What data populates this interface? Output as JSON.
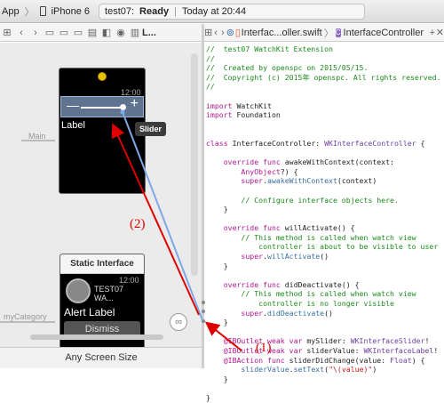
{
  "toolbar": {
    "scheme": "App",
    "separator": "〉",
    "device": "iPhone 6",
    "status_app": "test07:",
    "status_state": "Ready",
    "status_divider": "|",
    "status_time": "Today at 20:44"
  },
  "left_jump": {
    "crumb": "L..."
  },
  "right_jump": {
    "file": "Interfac...oller.swift",
    "sep": "〉",
    "class_name": "InterfaceController"
  },
  "canvas": {
    "time1": "12:00",
    "time2": "12:00",
    "label": "Label",
    "tooltip": "Slider",
    "main_segue": "Main",
    "category_segue": "myCategory",
    "static_title": "Static Interface",
    "app_name": "TEST07 WA...",
    "alert_label": "Alert Label",
    "dismiss": "Dismiss"
  },
  "bottom": {
    "size_label": "Any Screen Size"
  },
  "annotations": {
    "a1": "(1)",
    "a2": "(2)"
  },
  "code": {
    "l1": "//  test07 WatchKit Extension",
    "l2": "//",
    "l3": "//  Created by openspc on 2015/05/15.",
    "l4": "//  Copyright (c) 2015年 openspc. All rights reserved.",
    "l5": "//",
    "l7a": "import",
    "l7b": " WatchKit",
    "l8a": "import",
    "l8b": " Foundation",
    "l11a": "class",
    "l11b": " InterfaceController: ",
    "l11c": "WKInterfaceController",
    "l11d": " {",
    "l13a": "    override func",
    "l13b": " awakeWithContext(context:",
    "l14a": "        AnyObject",
    "l14b": "?) {",
    "l15a": "        super",
    "l15b": ".",
    "l15c": "awakeWithContext",
    "l15d": "(context)",
    "l17": "        // Configure interface objects here.",
    "l18": "    }",
    "l20a": "    override func",
    "l20b": " willActivate() {",
    "l21": "        // This method is called when watch view",
    "l22": "            controller is about to be visible to user",
    "l23a": "        super",
    "l23b": ".",
    "l23c": "willActivate",
    "l23d": "()",
    "l24": "    }",
    "l26a": "    override func",
    "l26b": " didDeactivate() {",
    "l27": "        // This method is called when watch view",
    "l28": "            controller is no longer visible",
    "l29a": "        super",
    "l29b": ".",
    "l29c": "didDeactivate",
    "l29d": "()",
    "l30": "    }",
    "l32a": "    @IBOutlet weak var",
    "l32b": " mySlider: ",
    "l32c": "WKInterfaceSlider",
    "l32d": "!",
    "l33a": "    @IBOutlet weak var",
    "l33b": " sliderValue: ",
    "l33c": "WKInterfaceLabel",
    "l33d": "!",
    "l34a": "    @IBAction func",
    "l34b": " sliderDidChange(value: ",
    "l34c": "Float",
    "l34d": ") {",
    "l35a": "        sliderValue",
    "l35b": ".",
    "l35c": "setText",
    "l35d": "(",
    "l35e": "\"\\(value)\"",
    "l35f": ")",
    "l36": "    }",
    "l38": "}"
  },
  "colors": {
    "annotation": "#dd0000",
    "connection": "#7fa8e8",
    "comment": "#1d8a1d",
    "keyword": "#b0178f"
  }
}
